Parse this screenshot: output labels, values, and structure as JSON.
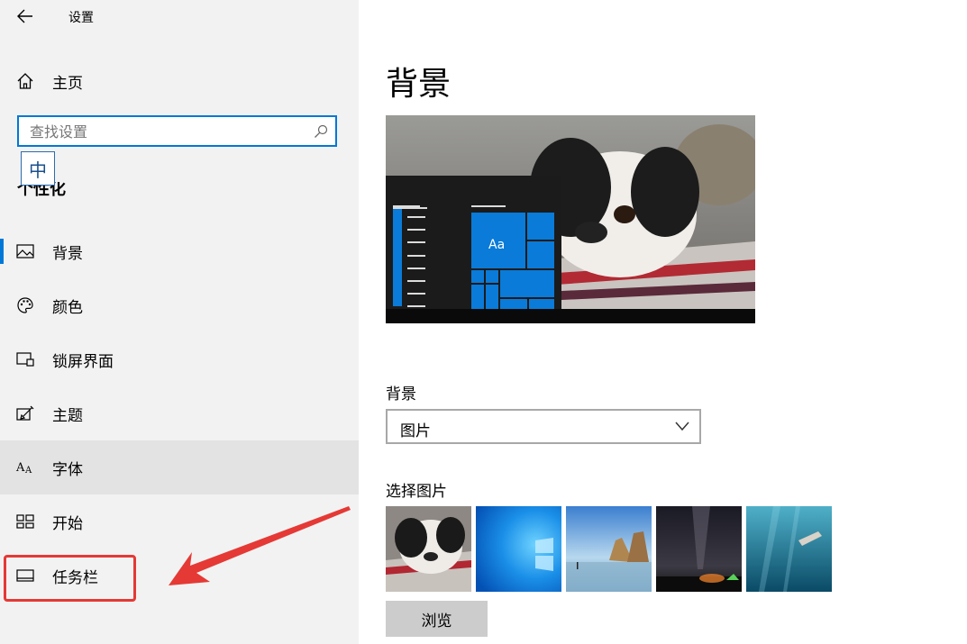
{
  "window": {
    "title": "设置"
  },
  "sidebar": {
    "home_label": "主页",
    "search": {
      "placeholder": "查找设置",
      "value": ""
    },
    "ime_indicator": "中",
    "section_title": "个性化",
    "items": [
      {
        "label": "背景",
        "icon": "picture-icon",
        "active": true
      },
      {
        "label": "颜色",
        "icon": "palette-icon"
      },
      {
        "label": "锁屏界面",
        "icon": "lock-screen-icon"
      },
      {
        "label": "主题",
        "icon": "theme-brush-icon"
      },
      {
        "label": "字体",
        "icon": "font-icon",
        "hovered": true
      },
      {
        "label": "开始",
        "icon": "start-grid-icon"
      },
      {
        "label": "任务栏",
        "icon": "taskbar-icon",
        "highlighted": true
      }
    ]
  },
  "main": {
    "page_title": "背景",
    "preview": {
      "tile_text": "Aa"
    },
    "background_label": "背景",
    "background_value": "图片",
    "choose_label": "选择图片",
    "thumbnails": [
      "dog-photo",
      "windows-blue",
      "beach-rocks",
      "night-sky",
      "underwater-diver"
    ],
    "browse_label": "浏览"
  },
  "colors": {
    "accent": "#0078d7",
    "annotation": "#e53935"
  }
}
